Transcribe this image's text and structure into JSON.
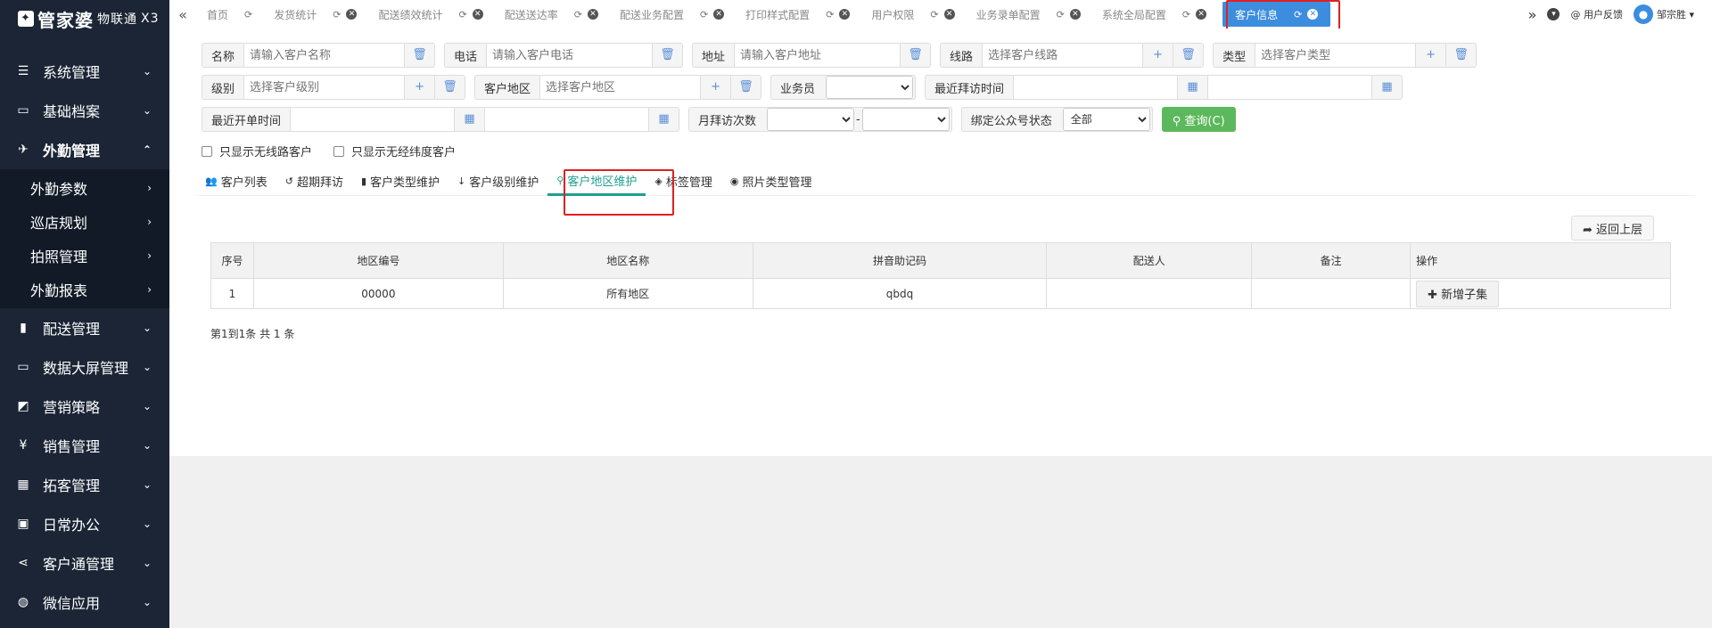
{
  "logo": {
    "brand": "管家婆",
    "sub": "物联通",
    "badge": "X3"
  },
  "sidebar": {
    "items": [
      {
        "icon": "sliders-icon",
        "glyph": "☰",
        "label": "系统管理"
      },
      {
        "icon": "folder-icon",
        "glyph": "▭",
        "label": "基础档案"
      },
      {
        "icon": "plane-icon",
        "glyph": "✈",
        "label": "外勤管理",
        "open": true
      },
      {
        "icon": "truck-icon",
        "glyph": "▮",
        "label": "配送管理"
      },
      {
        "icon": "monitor-icon",
        "glyph": "▭",
        "label": "数据大屏管理"
      },
      {
        "icon": "chart-icon",
        "glyph": "◩",
        "label": "营销策略"
      },
      {
        "icon": "yen-icon",
        "glyph": "¥",
        "label": "销售管理"
      },
      {
        "icon": "grid-icon",
        "glyph": "▦",
        "label": "拓客管理"
      },
      {
        "icon": "briefcase-icon",
        "glyph": "▣",
        "label": "日常办公"
      },
      {
        "icon": "share-icon",
        "glyph": "⋖",
        "label": "客户通管理"
      },
      {
        "icon": "wechat-icon",
        "glyph": "◍",
        "label": "微信应用"
      }
    ],
    "submenu": [
      {
        "label": "外勤参数"
      },
      {
        "label": "巡店规划"
      },
      {
        "label": "拍照管理"
      },
      {
        "label": "外勤报表"
      }
    ]
  },
  "topbar": {
    "tabs": [
      {
        "label": "首页"
      },
      {
        "label": "发货统计"
      },
      {
        "label": "配送绩效统计"
      },
      {
        "label": "配送送达率"
      },
      {
        "label": "配送业务配置"
      },
      {
        "label": "打印样式配置"
      },
      {
        "label": "用户权限"
      },
      {
        "label": "业务录单配置"
      },
      {
        "label": "系统全局配置"
      }
    ],
    "active_tab": "客户信息",
    "feedback": "用户反馈",
    "user": "邹宗胜"
  },
  "filters": {
    "name": {
      "label": "名称",
      "placeholder": "请输入客户名称"
    },
    "phone": {
      "label": "电话",
      "placeholder": "请输入客户电话"
    },
    "address": {
      "label": "地址",
      "placeholder": "请输入客户地址"
    },
    "route": {
      "label": "线路",
      "placeholder": "选择客户线路"
    },
    "type": {
      "label": "类型",
      "placeholder": "选择客户类型"
    },
    "level": {
      "label": "级别",
      "placeholder": "选择客户级别"
    },
    "region": {
      "label": "客户地区",
      "placeholder": "选择客户地区"
    },
    "salesman": {
      "label": "业务员"
    },
    "last_visit": {
      "label": "最近拜访时间"
    },
    "last_order": {
      "label": "最近开单时间"
    },
    "monthly_visits": {
      "label": "月拜访次数",
      "separator": "-"
    },
    "wechat_bind": {
      "label": "绑定公众号状态",
      "value": "全部"
    },
    "query_button": "查询(C)",
    "check_no_route": "只显示无线路客户",
    "check_no_coords": "只显示无经纬度客户"
  },
  "subtabs": [
    {
      "icon": "users-icon",
      "glyph": "👥",
      "label": "客户列表"
    },
    {
      "icon": "history-icon",
      "glyph": "↺",
      "label": "超期拜访"
    },
    {
      "icon": "bookmark-icon",
      "glyph": "▮",
      "label": "客户类型维护"
    },
    {
      "icon": "level-icon",
      "glyph": "↓",
      "label": "客户级别维护"
    },
    {
      "icon": "map-pin-icon",
      "glyph": "⚲",
      "label": "客户地区维护",
      "active": true
    },
    {
      "icon": "tags-icon",
      "glyph": "◈",
      "label": "标签管理"
    },
    {
      "icon": "camera-icon",
      "glyph": "◉",
      "label": "照片类型管理"
    }
  ],
  "back_button": "返回上层",
  "table": {
    "headers": [
      "序号",
      "地区编号",
      "地区名称",
      "拼音助记码",
      "配送人",
      "备注",
      "操作"
    ],
    "rows": [
      {
        "index": "1",
        "code": "00000",
        "name": "所有地区",
        "pinyin": "qbdq",
        "deliverer": "",
        "remark": "",
        "action": "新增子集"
      }
    ]
  },
  "pager": "第1到1条 共 1 条"
}
